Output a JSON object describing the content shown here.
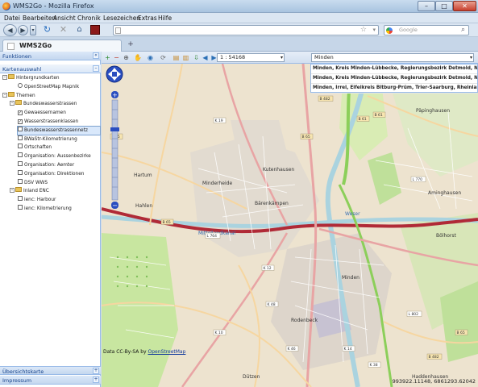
{
  "window": {
    "title": "WMS2Go - Mozilla Firefox",
    "controls": [
      "–",
      "□",
      "✕"
    ]
  },
  "menu": [
    {
      "label": "Datei"
    },
    {
      "label": "Bearbeiten"
    },
    {
      "label": "Ansicht"
    },
    {
      "label": "Chronik"
    },
    {
      "label": "Lesezeichen"
    },
    {
      "label": "Extras"
    },
    {
      "label": "Hilfe"
    }
  ],
  "nav": {
    "search_placeholder": "Google"
  },
  "tab": {
    "label": "WMS2Go",
    "new_tab": "+"
  },
  "left_panel": {
    "header": "Funktionen",
    "section": "Kartenauswahl",
    "tree": [
      {
        "label": "Hintergrundkarten",
        "kind": "folder",
        "level": 0,
        "expand": "–"
      },
      {
        "label": "OpenStreetMap Mapnik",
        "kind": "radio",
        "level": 2
      },
      {
        "label": "Themen",
        "kind": "folder",
        "level": 0,
        "expand": "–"
      },
      {
        "label": "Bundeswasserstrassen",
        "kind": "folder",
        "level": 1,
        "expand": "–"
      },
      {
        "label": "Gewaessernamen",
        "kind": "check",
        "level": 2,
        "checked": true
      },
      {
        "label": "Wasserstrassenklassen",
        "kind": "check",
        "level": 2,
        "checked": true
      },
      {
        "label": "Bundeswasserstrassennetz",
        "kind": "check",
        "level": 2,
        "checked": false,
        "selected": true
      },
      {
        "label": "BWaStr-Kilometrierung",
        "kind": "check",
        "level": 2,
        "checked": false
      },
      {
        "label": "Ortschaften",
        "kind": "check",
        "level": 2,
        "checked": false
      },
      {
        "label": "Organisation: Aussenbezirke",
        "kind": "check",
        "level": 2,
        "checked": false
      },
      {
        "label": "Organisation: Aemter",
        "kind": "check",
        "level": 2,
        "checked": false
      },
      {
        "label": "Organisation: Direktionen",
        "kind": "check",
        "level": 2,
        "checked": false
      },
      {
        "label": "DSV WWS",
        "kind": "check",
        "level": 2,
        "checked": false
      },
      {
        "label": "Inland ENC",
        "kind": "folder",
        "level": 1,
        "expand": "–"
      },
      {
        "label": "ienc: Harbour",
        "kind": "check",
        "level": 2,
        "checked": false
      },
      {
        "label": "ienc: Kilometrierung",
        "kind": "check",
        "level": 2,
        "checked": false
      }
    ],
    "bottom_sections": [
      "Übersichtskarte",
      "Impressum"
    ]
  },
  "map": {
    "scale": "1 : 54168",
    "search_value": "Minden",
    "results": [
      "Minden, Kreis Minden-Lübbecke, Regierungsbezirk Detmold, Nordrhein-Westfalen",
      "Minden, Kreis Minden-Lübbecke, Regierungsbezirk Detmold, Nordrhein-Westfalen",
      "Minden, Irrel, Eifelkreis Bitburg-Prüm, Trier-Saarburg, Rheinland-Pfalz"
    ],
    "attribution_prefix": "Data CC-By-SA by ",
    "attribution_link": "OpenStreetMap",
    "coordinates": "993922.11148, 6861293.62042",
    "labels": [
      {
        "text": "Minderheide"
      },
      {
        "text": "Kutenhausen"
      },
      {
        "text": "Bärenkämpen"
      },
      {
        "text": "Mittellandkanal"
      },
      {
        "text": "Weser"
      },
      {
        "text": "Minden"
      },
      {
        "text": "Dützen"
      },
      {
        "text": "Rodenbeck"
      },
      {
        "text": "Bölhorst"
      },
      {
        "text": "Haddenhausen"
      },
      {
        "text": "Aminghausen"
      },
      {
        "text": "Päpinghausen"
      },
      {
        "text": "Hahlen"
      },
      {
        "text": "Hartum"
      }
    ],
    "road_shields": [
      "B 65",
      "K 19",
      "B 61",
      "K 12",
      "B 482",
      "L 764",
      "B 65",
      "K 10",
      "K 48",
      "B 61",
      "L 770",
      "K 46",
      "K 14",
      "B 65",
      "L 802",
      "B 482",
      "K 38",
      "B 65"
    ]
  },
  "colors": {
    "accent": "#15428b",
    "map_background": "#ede3cf",
    "canal": "#aad3df",
    "motorway_red": "#b02a37",
    "primary_road": "#e8a4a4",
    "secondary_road": "#f6d6a0",
    "green_road": "#8ccf5a",
    "forest": "#bfe09a"
  },
  "icons": [
    "firefox-logo-icon",
    "back-icon",
    "forward-icon",
    "reload-icon",
    "stop-icon",
    "home-icon",
    "bookmark-star-icon",
    "google-icon",
    "pan-icon",
    "zoom-in-icon",
    "zoom-out-icon",
    "zoom-extent-icon",
    "refresh-icon",
    "print-icon",
    "prev-extent-icon",
    "next-extent-icon"
  ]
}
